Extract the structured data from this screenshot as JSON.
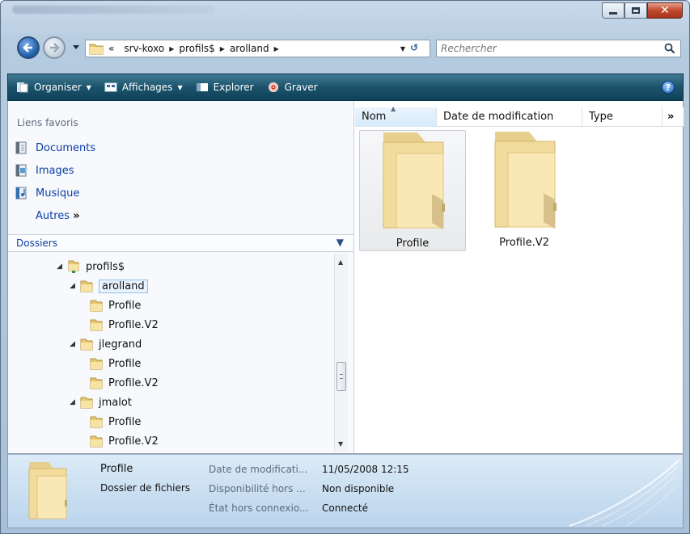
{
  "window": {
    "caption_buttons": [
      "minimize",
      "maximize",
      "close"
    ]
  },
  "address": {
    "back_icon": "back-arrow-icon",
    "forward_icon": "forward-arrow-icon",
    "overflow": "«",
    "crumbs": [
      "srv-koxo",
      "profils$",
      "arolland"
    ],
    "search_placeholder": "Rechercher"
  },
  "toolbar": {
    "organiser": "Organiser",
    "affichages": "Affichages",
    "explorer": "Explorer",
    "graver": "Graver",
    "help": "?"
  },
  "nav": {
    "favorites_title": "Liens favoris",
    "favorites": [
      {
        "label": "Documents",
        "icon": "documents-icon"
      },
      {
        "label": "Images",
        "icon": "images-icon"
      },
      {
        "label": "Musique",
        "icon": "music-icon"
      }
    ],
    "more_label": "Autres",
    "more_chevrons": "»",
    "folders_title": "Dossiers",
    "tree": [
      {
        "label": "profils$",
        "level": 0,
        "expanded": true,
        "kind": "share"
      },
      {
        "label": "arolland",
        "level": 1,
        "expanded": true,
        "selected": true
      },
      {
        "label": "Profile",
        "level": 2
      },
      {
        "label": "Profile.V2",
        "level": 2
      },
      {
        "label": "jlegrand",
        "level": 1,
        "expanded": true
      },
      {
        "label": "Profile",
        "level": 2
      },
      {
        "label": "Profile.V2",
        "level": 2
      },
      {
        "label": "jmalot",
        "level": 1,
        "expanded": true
      },
      {
        "label": "Profile",
        "level": 2
      },
      {
        "label": "Profile.V2",
        "level": 2
      }
    ]
  },
  "files": {
    "columns": [
      "Nom",
      "Date de modification",
      "Type",
      "»"
    ],
    "items": [
      {
        "label": "Profile",
        "selected": true
      },
      {
        "label": "Profile.V2",
        "selected": false
      }
    ]
  },
  "details": {
    "name": "Profile",
    "kind": "Dossier de fichiers",
    "rows": [
      {
        "key": "Date de modificati...",
        "value": "11/05/2008 12:15"
      },
      {
        "key": "Disponibilité hors ...",
        "value": "Non disponible"
      },
      {
        "key": "État hors connexio...",
        "value": "Connecté"
      }
    ]
  },
  "colors": {
    "toolbar": "#1c536b",
    "link": "#0c3fa8",
    "selection": "#8fc0ea"
  }
}
